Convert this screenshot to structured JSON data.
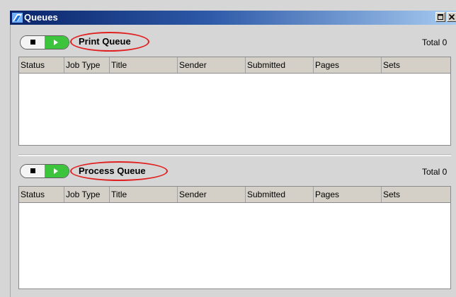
{
  "window": {
    "title": "Queues"
  },
  "print_queue": {
    "title": "Print Queue",
    "total": "Total 0",
    "columns": [
      "Status",
      "Job Type",
      "Title",
      "Sender",
      "Submitted",
      "Pages",
      "Sets"
    ]
  },
  "process_queue": {
    "title": "Process Queue",
    "total": "Total 0",
    "columns": [
      "Status",
      "Job Type",
      "Title",
      "Sender",
      "Submitted",
      "Pages",
      "Sets"
    ]
  },
  "icons": {
    "app": "queues-app-icon",
    "stop": "stop-icon",
    "play": "play-icon",
    "maximize": "maximize-icon",
    "close": "close-icon"
  },
  "colors": {
    "title_bar": "#0a246a",
    "highlight_oval": "#e02020",
    "play_button": "#3cc43c"
  }
}
